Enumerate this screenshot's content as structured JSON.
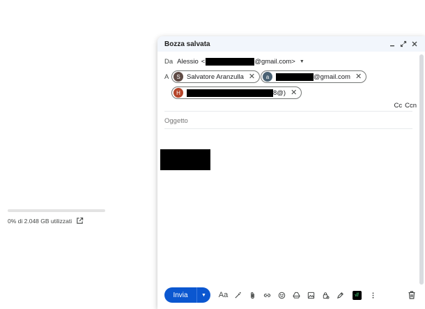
{
  "storage": {
    "text": "0% di 2.048 GB utilizzati",
    "percent_used": 0
  },
  "compose": {
    "title": "Bozza salvata",
    "header_icons": [
      "minimize-icon",
      "expand-icon",
      "close-icon"
    ],
    "from": {
      "label": "Da",
      "name": "Alessio",
      "lt": "<",
      "email_suffix": "@gmail.com>"
    },
    "to": {
      "label": "A",
      "recipients": [
        {
          "initial": "S",
          "name": "Salvatore Aranzulla",
          "avatar_color": "#5f4b45"
        },
        {
          "initial": "a",
          "email_suffix": "@gmail.com",
          "avatar_color": "#4a6274"
        },
        {
          "initial": "H",
          "email_suffix": "8@)",
          "avatar_color": "#b5452a"
        }
      ]
    },
    "cc_label": "Cc",
    "bcc_label": "Ccn",
    "subject_placeholder": "Oggetto",
    "send_label": "Invia",
    "format_label": "Aa",
    "extension_label": "√/",
    "colors": {
      "send": "#0b57d0",
      "header_bg": "#f2f6fc"
    }
  }
}
